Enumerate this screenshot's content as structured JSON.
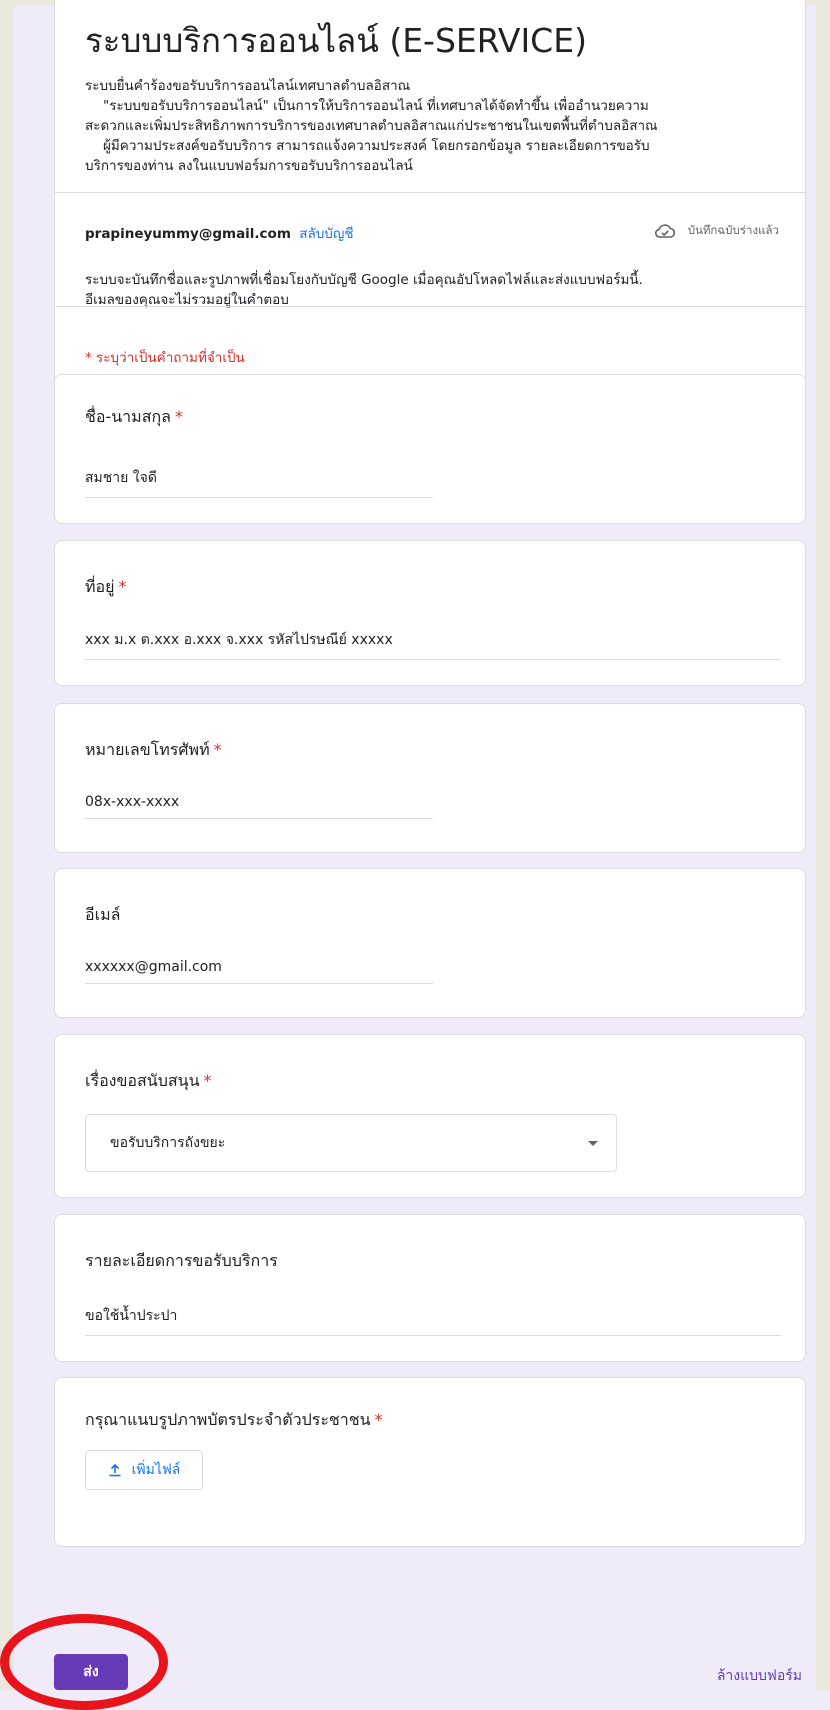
{
  "form": {
    "title": "ระบบบริการออนไลน์ (E-SERVICE)",
    "description_lines": [
      "ระบบยื่นคำร้องขอรับบริการออนไลน์เทศบาลตำบลอิสาณ",
      "\"ระบบขอรับบริการออนไลน์\" เป็นการให้บริการออนไลน์ ที่เทศบาลได้จัดทำขึ้น เพื่ออำนวยความ",
      "สะดวกและเพิ่มประสิทธิภาพการบริการของเทศบาลตำบลอิสาณแก่ประชาชนในเขตพื้นที่ตำบลอิสาณ",
      "ผู้มีความประสงค์ขอรับบริการ สามารถแจ้งความประสงค์ โดยกรอกข้อมูล รายละเอียดการขอรับ",
      "บริการของท่าน ลงในแบบฟอร์มการขอรับบริการออนไลน์"
    ]
  },
  "account": {
    "email": "prapineyummy@gmail.com",
    "switch_label": "สลับบัญชี",
    "draft_status": "บันทึกฉบับร่างแล้ว",
    "draft_icon": "cloud-done-icon",
    "note_lines": [
      "ระบบจะบันทึกชื่อและรูปภาพที่เชื่อมโยงกับบัญชี Google เมื่อคุณอัปโหลดไฟล์และส่งแบบฟอร์มนี้.",
      "อีเมลของคุณจะไม่รวมอยู่ในคำตอบ"
    ]
  },
  "required_note": "* ระบุว่าเป็นคำถามที่จำเป็น",
  "questions": [
    {
      "title": "ชื่อ-นามสกุล",
      "required_mark": "*",
      "value": "สมชาย ใจดี"
    },
    {
      "title": "ที่อยู่",
      "required_mark": "*",
      "value": "xxx ม.x ต.xxx อ.xxx จ.xxx รหัสไปรษณีย์ xxxxx"
    },
    {
      "title": "หมายเลขโทรศัพท์",
      "required_mark": "*",
      "value": "08x-xxx-xxxx"
    },
    {
      "title": "อีเมล์",
      "value": "xxxxxx@gmail.com"
    },
    {
      "title": "เรื่องขอสนับสนุน",
      "required_mark": "*",
      "value": "ขอรับบริการถังขยะ"
    },
    {
      "title": "รายละเอียดการขอรับบริการ",
      "value": "ขอใช้น้ำประปา"
    },
    {
      "title": "กรุณาแนบรูปภาพบัตรประจำตัวประชาชน",
      "required_mark": "*",
      "button_label": "เพิ่มไฟล์",
      "button_icon": "upload-icon"
    }
  ],
  "footer": {
    "submit_label": "ส่ง",
    "clear_label": "ล้างแบบฟอร์ม"
  },
  "colors": {
    "page_background": "#f0ebf8",
    "accent": "#673ab7",
    "required": "#d93025",
    "link": "#1a73e8",
    "highlight": "#e8141c"
  }
}
